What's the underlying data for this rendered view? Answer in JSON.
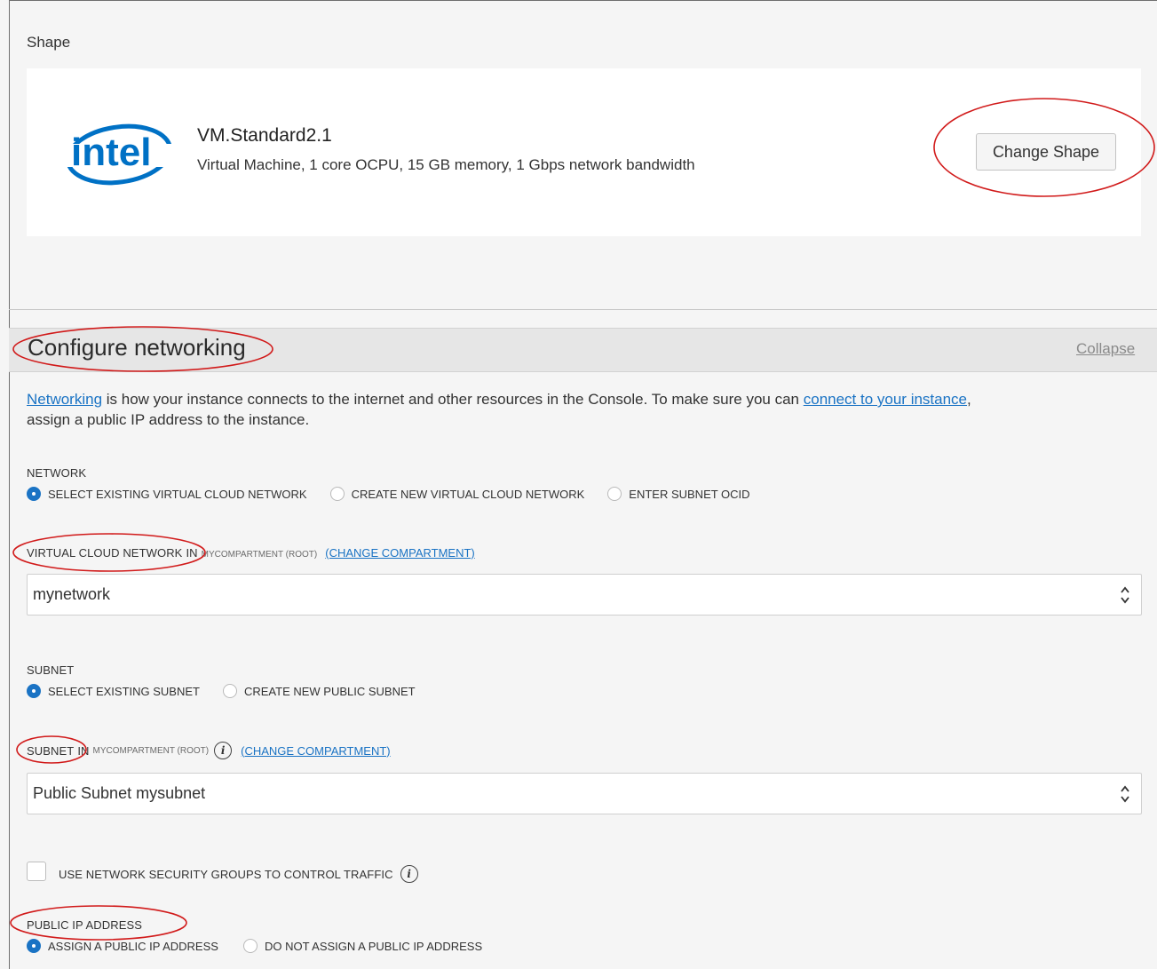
{
  "shape": {
    "section_label": "Shape",
    "logo_text": "intel",
    "name": "VM.Standard2.1",
    "description": "Virtual Machine, 1 core OCPU, 15 GB memory, 1 Gbps network bandwidth",
    "change_button": "Change Shape"
  },
  "networking": {
    "title": "Configure networking",
    "collapse": "Collapse",
    "intro": {
      "link1": "Networking",
      "text1": " is how your instance connects to the internet and other resources in the Console. To make sure you can ",
      "link2": "connect to your instance",
      "text2": ",",
      "text3": "assign a public IP address to the instance."
    },
    "network": {
      "label": "NETWORK",
      "options": [
        {
          "label": "SELECT EXISTING VIRTUAL CLOUD NETWORK",
          "checked": true
        },
        {
          "label": "CREATE NEW VIRTUAL CLOUD NETWORK",
          "checked": false
        },
        {
          "label": "ENTER SUBNET OCID",
          "checked": false
        }
      ]
    },
    "vcn": {
      "label": "VIRTUAL CLOUD NETWORK",
      "in": "IN",
      "compartment": "MYCOMPARTMENT (ROOT)",
      "change_link": "(CHANGE COMPARTMENT)",
      "selected": "mynetwork"
    },
    "subnet_choice": {
      "label": "SUBNET",
      "options": [
        {
          "label": "SELECT EXISTING SUBNET",
          "checked": true
        },
        {
          "label": "CREATE NEW PUBLIC SUBNET",
          "checked": false
        }
      ]
    },
    "subnet": {
      "label": "SUBNET",
      "in": "IN",
      "compartment": "MYCOMPARTMENT (ROOT)",
      "change_link": "(CHANGE COMPARTMENT)",
      "selected": "Public Subnet mysubnet"
    },
    "nsg": {
      "label": "USE NETWORK SECURITY GROUPS TO CONTROL TRAFFIC",
      "checked": false
    },
    "public_ip": {
      "label": "PUBLIC IP ADDRESS",
      "options": [
        {
          "label": "ASSIGN A PUBLIC IP ADDRESS",
          "checked": true
        },
        {
          "label": "DO NOT ASSIGN A PUBLIC IP ADDRESS",
          "checked": false
        }
      ]
    }
  },
  "colors": {
    "link_blue": "#1a73c4",
    "annotation_red": "#d11a1a",
    "intel_blue": "#0071c5"
  }
}
